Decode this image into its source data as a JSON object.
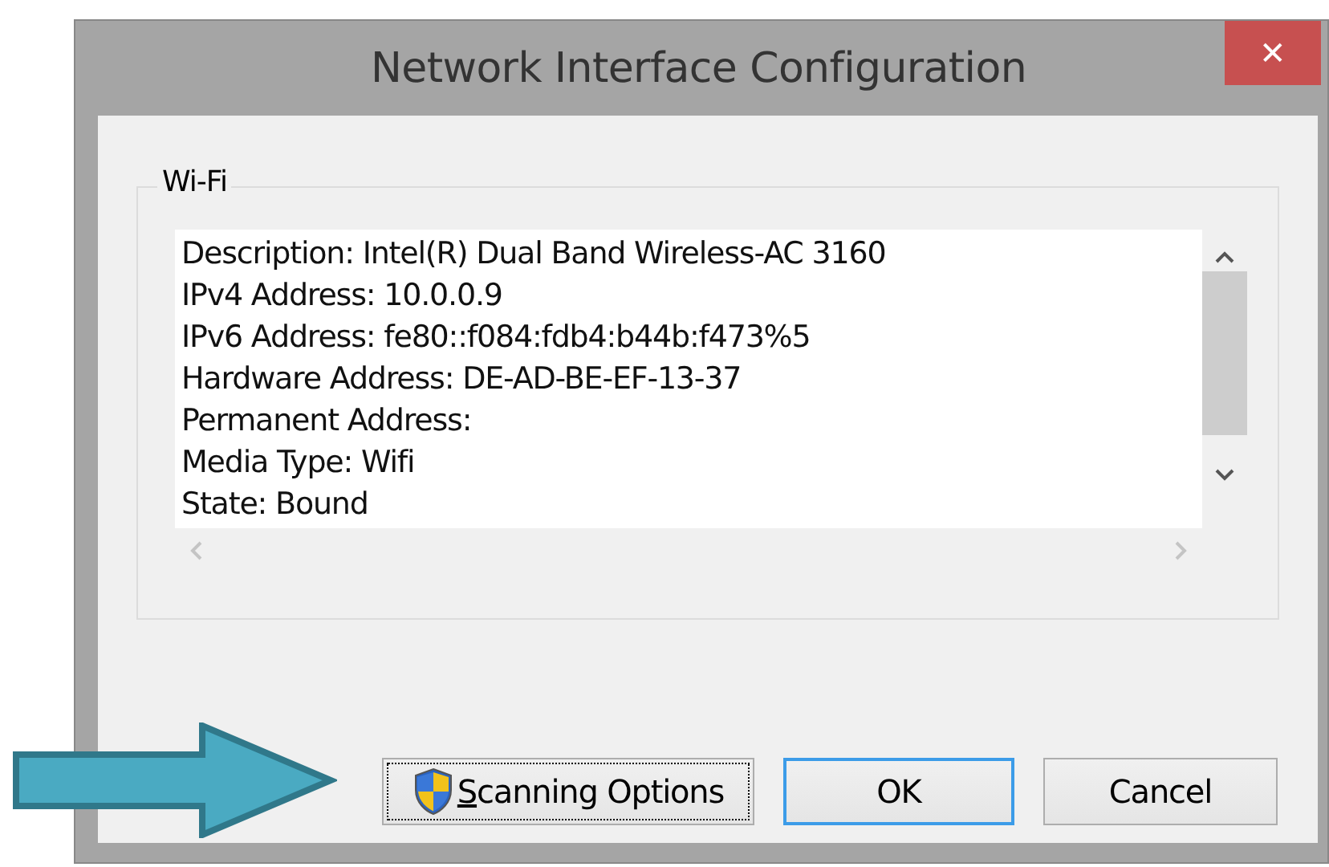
{
  "window": {
    "title": "Network Interface Configuration",
    "close_glyph": "✕"
  },
  "group": {
    "label": "Wi-Fi",
    "lines": [
      "Description: Intel(R) Dual Band Wireless-AC 3160",
      "IPv4 Address: 10.0.0.9",
      "IPv6 Address: fe80::f084:fdb4:b44b:f473%5",
      "Hardware Address: DE-AD-BE-EF-13-37",
      "Permanent Address:",
      "Media Type: Wifi",
      "State: Bound"
    ]
  },
  "buttons": [
    {
      "label": "Scanning Options",
      "shield": true,
      "focused": true,
      "default": false
    },
    {
      "label": "OK",
      "shield": false,
      "focused": false,
      "default": true
    },
    {
      "label": "Cancel",
      "shield": false,
      "focused": false,
      "default": false
    }
  ],
  "callout_arrow": true
}
